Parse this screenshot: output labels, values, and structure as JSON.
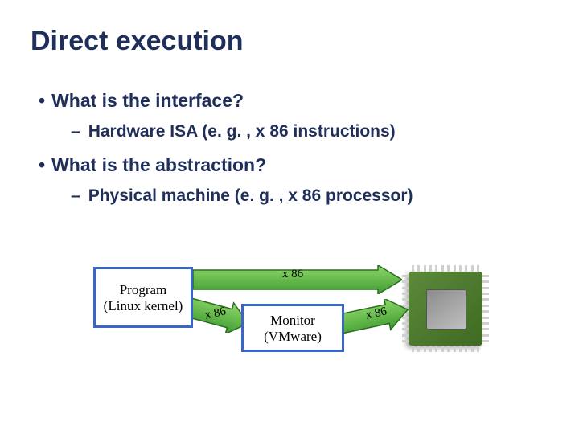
{
  "title": "Direct execution",
  "bullets": {
    "q1": "What is the interface?",
    "a1": "Hardware ISA (e. g. , x 86 instructions)",
    "q2": "What is the abstraction?",
    "a2": "Physical machine (e. g. , x 86 processor)"
  },
  "diagram": {
    "program": {
      "line1": "Program",
      "line2": "(Linux kernel)"
    },
    "monitor": {
      "line1": "Monitor",
      "line2": "(VMware)"
    },
    "arrow_top": "x 86",
    "arrow_left": "x 86",
    "arrow_right": "x 86"
  }
}
